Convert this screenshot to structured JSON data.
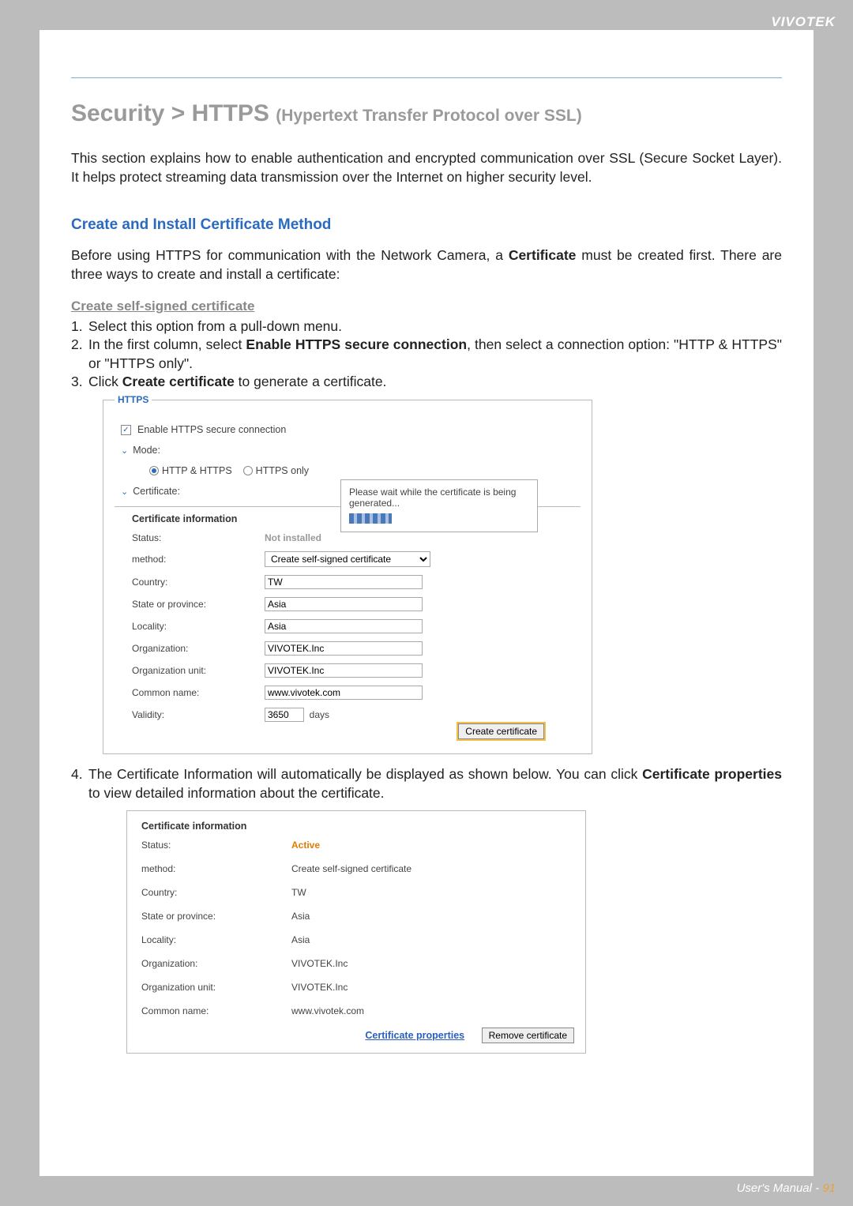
{
  "brand": "VIVOTEK",
  "title_main": "Security >  HTTPS ",
  "title_sub": "(Hypertext Transfer Protocol over SSL)",
  "intro": "This section explains how to enable authentication and encrypted communication over SSL (Secure Socket Layer). It helps protect streaming data transmission over the Internet on higher security level.",
  "section_heading": "Create and Install Certificate Method",
  "section_body_pre": "Before using HTTPS for communication with the Network Camera, a ",
  "section_body_bold": "Certificate",
  "section_body_post": " must be created first. There are three ways to create and install a certificate:",
  "step_heading": "Create self-signed certificate",
  "steps": {
    "s1": "Select this option from a pull-down menu.",
    "s2_pre": "In the first column, select ",
    "s2_b": "Enable HTTPS secure connection",
    "s2_post": ", then select a connection option: \"HTTP & HTTPS\" or \"HTTPS only\".",
    "s3_pre": "Click ",
    "s3_b": "Create certificate",
    "s3_post": " to generate a certificate.",
    "s4_pre": "The Certificate Information will automatically be displayed as shown below. You can click ",
    "s4_b": "Certificate properties",
    "s4_post": " to view detailed information about the certificate."
  },
  "shot1": {
    "legend": "HTTPS",
    "enable_label": "Enable HTTPS secure connection",
    "mode_label": "Mode:",
    "mode_opt1": "HTTP & HTTPS",
    "mode_opt2": "HTTPS only",
    "cert_label": "Certificate:",
    "cert_info_hdr": "Certificate information",
    "rows": {
      "status_l": "Status:",
      "status_v": "Not installed",
      "method_l": "method:",
      "method_v": "Create self-signed certificate",
      "country_l": "Country:",
      "country_v": "TW",
      "state_l": "State or province:",
      "state_v": "Asia",
      "locality_l": "Locality:",
      "locality_v": "Asia",
      "org_l": "Organization:",
      "org_v": "VIVOTEK.Inc",
      "orgu_l": "Organization unit:",
      "orgu_v": "VIVOTEK.Inc",
      "cn_l": "Common name:",
      "cn_v": "www.vivotek.com",
      "valid_l": "Validity:",
      "valid_v": "3650",
      "valid_unit": "days"
    },
    "create_btn": "Create certificate",
    "popup": "Please wait while the certificate is being generated..."
  },
  "shot2": {
    "hdr": "Certificate information",
    "rows": {
      "status_l": "Status:",
      "status_v": "Active",
      "method_l": "method:",
      "method_v": "Create self-signed certificate",
      "country_l": "Country:",
      "country_v": "TW",
      "state_l": "State or province:",
      "state_v": "Asia",
      "locality_l": "Locality:",
      "locality_v": "Asia",
      "org_l": "Organization:",
      "org_v": "VIVOTEK.Inc",
      "orgu_l": "Organization unit:",
      "orgu_v": "VIVOTEK.Inc",
      "cn_l": "Common name:",
      "cn_v": "www.vivotek.com"
    },
    "props_link": "Certificate properties",
    "remove_btn": "Remove certificate"
  },
  "footer_text": "User's Manual - ",
  "footer_page": "91"
}
